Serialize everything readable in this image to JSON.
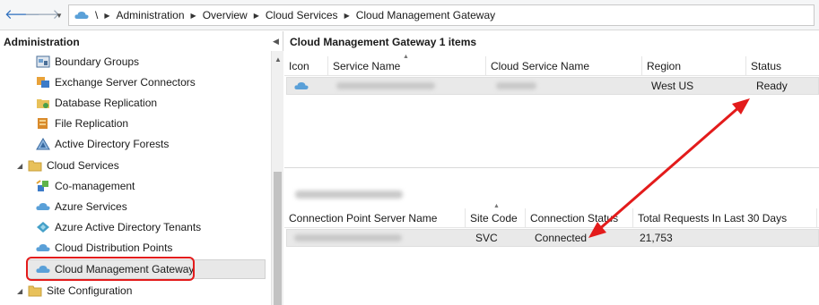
{
  "breadcrumb": {
    "root": "\\",
    "items": [
      "Administration",
      "Overview",
      "Cloud Services",
      "Cloud Management Gateway"
    ]
  },
  "left_pane": {
    "title": "Administration",
    "items": [
      {
        "label": "Boundary Groups",
        "icon": "boundary-groups-icon"
      },
      {
        "label": "Exchange Server Connectors",
        "icon": "exchange-connector-icon"
      },
      {
        "label": "Database Replication",
        "icon": "database-replication-icon"
      },
      {
        "label": "File Replication",
        "icon": "file-replication-icon"
      },
      {
        "label": "Active Directory Forests",
        "icon": "ad-forest-icon"
      },
      {
        "label": "Cloud Services",
        "icon": "folder-icon"
      },
      {
        "label": "Co-management",
        "icon": "co-management-icon"
      },
      {
        "label": "Azure Services",
        "icon": "cloud-icon"
      },
      {
        "label": "Azure Active Directory Tenants",
        "icon": "azure-ad-icon"
      },
      {
        "label": "Cloud Distribution Points",
        "icon": "cloud-icon"
      },
      {
        "label": "Cloud Management Gateway",
        "icon": "cloud-icon"
      },
      {
        "label": "Site Configuration",
        "icon": "folder-icon"
      }
    ]
  },
  "top_list": {
    "title": "Cloud Management Gateway 1 items",
    "columns": [
      "Icon",
      "Service Name",
      "Cloud Service Name",
      "Region",
      "Status"
    ],
    "rows": [
      {
        "region": "West US",
        "status": "Ready"
      }
    ]
  },
  "bottom_list": {
    "columns": [
      "Connection Point Server Name",
      "Site Code",
      "Connection Status",
      "Total Requests In Last 30 Days"
    ],
    "rows": [
      {
        "site_code": "SVC",
        "connection_status": "Connected",
        "total_requests": "21,753"
      }
    ]
  },
  "colors": {
    "annotation_red": "#e31b1b",
    "cloud_blue": "#5aa0d8",
    "folder_yellow": "#e8c15a"
  }
}
